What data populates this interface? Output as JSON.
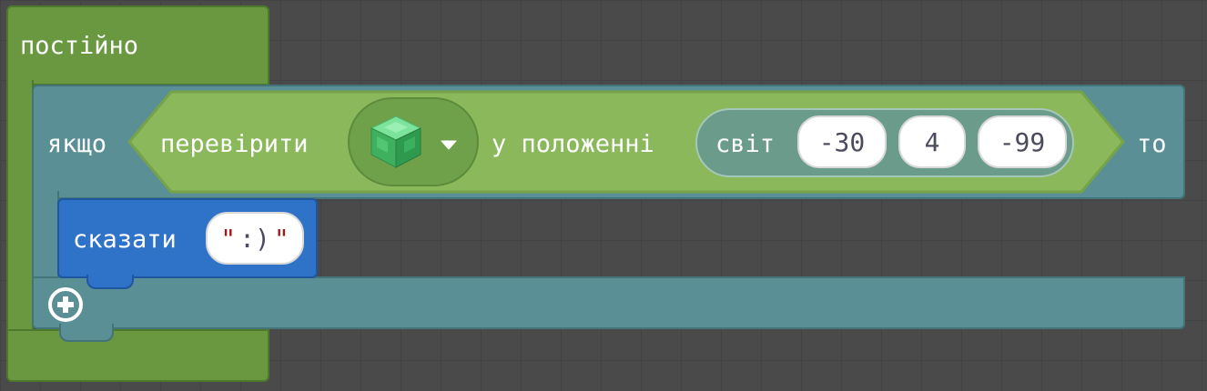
{
  "forever": {
    "label": "постійно"
  },
  "if_block": {
    "if_label": "якщо",
    "then_label": "то"
  },
  "check": {
    "label": "перевірити",
    "block_icon": "emerald-block-icon",
    "position_label": "у положенні"
  },
  "world": {
    "label": "світ",
    "x": "-30",
    "y": "4",
    "z": "-99"
  },
  "say": {
    "label": "сказати",
    "quote_open": "\"",
    "text": ":)",
    "quote_close": "\""
  },
  "add_icon": "plus-circle-icon",
  "colors": {
    "forever": "#6a9841",
    "if": "#5a8f95",
    "check": "#8ab85b",
    "say": "#2f73c8",
    "quote": "#a31515"
  }
}
